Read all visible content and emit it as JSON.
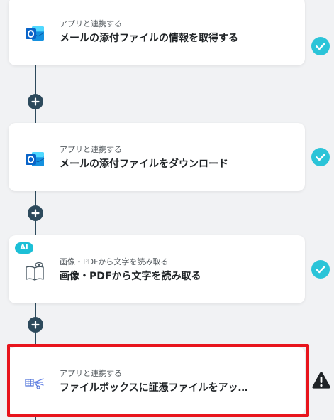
{
  "steps": [
    {
      "subtitle": "アプリと連携する",
      "title": "メールの添付ファイルの情報を取得する",
      "icon": "outlook-icon",
      "status": "complete"
    },
    {
      "subtitle": "アプリと連携する",
      "title": "メールの添付ファイルをダウンロード",
      "icon": "outlook-icon",
      "status": "complete"
    },
    {
      "badge": "AI",
      "subtitle": "画像・PDFから文字を読み取る",
      "title": "画像・PDFから文字を読み取る",
      "icon": "ocr-book-eye-icon",
      "status": "complete"
    },
    {
      "subtitle": "アプリと連携する",
      "title": "ファイルボックスに証憑ファイルをアッ…",
      "icon": "filebox-app-icon",
      "status": "warning"
    }
  ],
  "colors": {
    "complete": "#2bc4d8",
    "warning": "#1f2326",
    "connector": "#2d4a5c",
    "highlight": "#e8141c",
    "outlook": "#0a64c8",
    "ai_badge": "#1cbfd6"
  }
}
